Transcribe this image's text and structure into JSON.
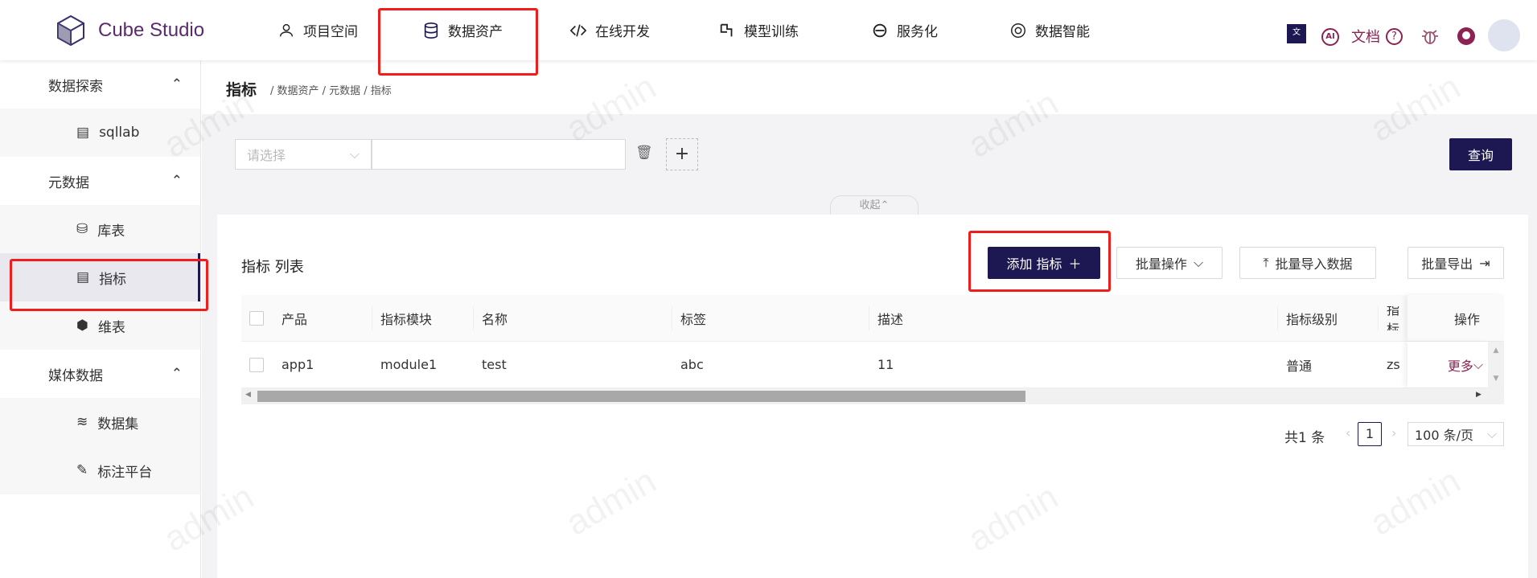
{
  "app": {
    "name": "Cube Studio"
  },
  "nav": [
    {
      "label": "项目空间",
      "icon": "team-icon"
    },
    {
      "label": "数据资产",
      "icon": "database-icon"
    },
    {
      "label": "在线开发",
      "icon": "code-icon"
    },
    {
      "label": "模型训练",
      "icon": "model-icon"
    },
    {
      "label": "服务化",
      "icon": "ie-icon"
    },
    {
      "label": "数据智能",
      "icon": "openai-icon"
    }
  ],
  "header_right": {
    "docs": "文档"
  },
  "sidebar": {
    "groups": [
      {
        "label": "数据探索",
        "items": [
          "sqllab"
        ]
      },
      {
        "label": "元数据",
        "items": [
          "库表",
          "指标",
          "维表"
        ]
      },
      {
        "label": "媒体数据",
        "items": [
          "数据集",
          "标注平台"
        ]
      }
    ],
    "active": "指标"
  },
  "breadcrumb": {
    "title": "指标",
    "path": "/ 数据资产 / 元数据 / 指标"
  },
  "filter": {
    "select_placeholder": "请选择",
    "query": "查询",
    "collapse": "收起"
  },
  "list": {
    "title": "指标 列表",
    "add": "添加 指标",
    "batch": "批量操作",
    "import": "批量导入数据",
    "export": "批量导出"
  },
  "table": {
    "columns": [
      "产品",
      "指标模块",
      "名称",
      "标签",
      "描述",
      "指标级别",
      "指标",
      "操作"
    ],
    "rows": [
      [
        "app1",
        "module1",
        "test",
        "abc",
        "11",
        "普通",
        "zs",
        "更多"
      ]
    ]
  },
  "pagination": {
    "total": "共1 条",
    "page": "1",
    "size": "100 条/页"
  },
  "watermark": "admin",
  "colors": {
    "primary": "#1e1852",
    "accent": "#8b2252",
    "highlight": "#f01d1d"
  }
}
